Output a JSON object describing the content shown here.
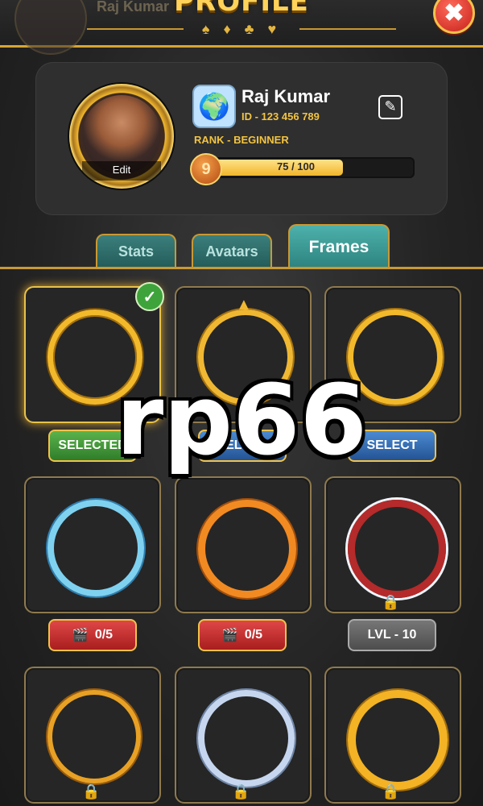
{
  "header": {
    "title": "PROFILE",
    "bg_name": "Raj Kumar",
    "suits": "♠ ♦ ♣ ♥",
    "close_symbol": "✖"
  },
  "profile": {
    "avatar_edit_label": "Edit",
    "name": "Raj Kumar",
    "id_text": "ID - 123 456 789",
    "rank_text": "RANK - BEGINNER",
    "level": "9",
    "xp_text": "75 / 100",
    "xp_fraction": 0.75
  },
  "tabs": [
    {
      "label": "Stats"
    },
    {
      "label": "Avatars"
    },
    {
      "label": "Frames",
      "active": true
    }
  ],
  "frames": [
    {
      "name": "gold-classic",
      "status": "selected",
      "button": "SELECTED"
    },
    {
      "name": "gold-sun",
      "status": "available",
      "button": "SELECT"
    },
    {
      "name": "gold-crown",
      "status": "available",
      "button": "SELECT"
    },
    {
      "name": "ice-crystal",
      "status": "locked",
      "button": "0/5"
    },
    {
      "name": "fox",
      "status": "locked",
      "button": "0/5"
    },
    {
      "name": "christmas",
      "status": "locked",
      "button": "LVL - 10"
    },
    {
      "name": "ruby-star",
      "status": "locked"
    },
    {
      "name": "flowers",
      "status": "locked"
    },
    {
      "name": "ribbon",
      "status": "locked"
    }
  ],
  "watermark": "rp66",
  "colors": {
    "gold": "#d7a531",
    "teal_tab": "#2c817d",
    "green": "#3ea33b",
    "red": "#c6211b"
  }
}
